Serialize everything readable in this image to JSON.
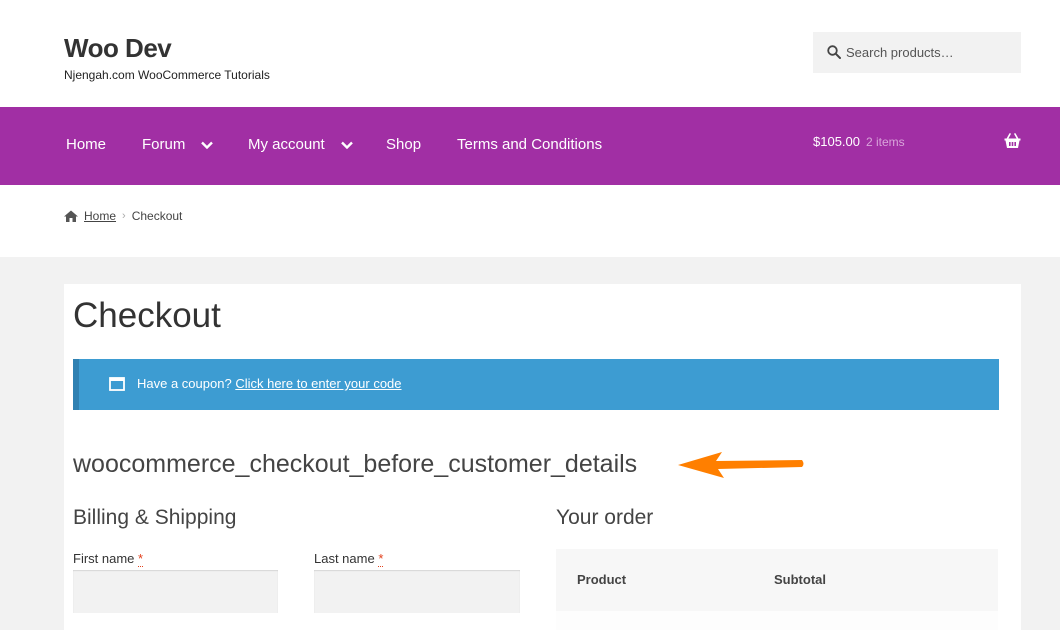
{
  "site": {
    "title": "Woo Dev",
    "description": "Njengah.com WooCommerce Tutorials"
  },
  "search": {
    "placeholder": "Search products…"
  },
  "nav": {
    "items": [
      {
        "label": "Home",
        "has_dropdown": false
      },
      {
        "label": "Forum",
        "has_dropdown": true
      },
      {
        "label": "My account",
        "has_dropdown": true
      },
      {
        "label": "Shop",
        "has_dropdown": false
      },
      {
        "label": "Terms and Conditions",
        "has_dropdown": false
      }
    ],
    "cart_total": "$105.00",
    "cart_count": "2 items"
  },
  "breadcrumb": {
    "home": "Home",
    "current": "Checkout"
  },
  "page": {
    "title": "Checkout",
    "coupon_prefix": "Have a coupon?",
    "coupon_link": "Click here to enter your code",
    "hook_text": "woocommerce_checkout_before_customer_details"
  },
  "billing": {
    "heading": "Billing & Shipping",
    "first_name_label": "First name",
    "last_name_label": "Last name",
    "required_mark": "*"
  },
  "order": {
    "heading": "Your order",
    "col_product": "Product",
    "col_subtotal": "Subtotal"
  },
  "colors": {
    "nav_bg": "#a12fa4",
    "coupon_bg": "#3d9cd2",
    "arrow": "#ff7f00"
  },
  "icons": {
    "search": "search-icon",
    "cart": "basket-icon",
    "home": "home-icon",
    "coupon": "window-icon",
    "dropdown": "chevron-down-icon"
  }
}
